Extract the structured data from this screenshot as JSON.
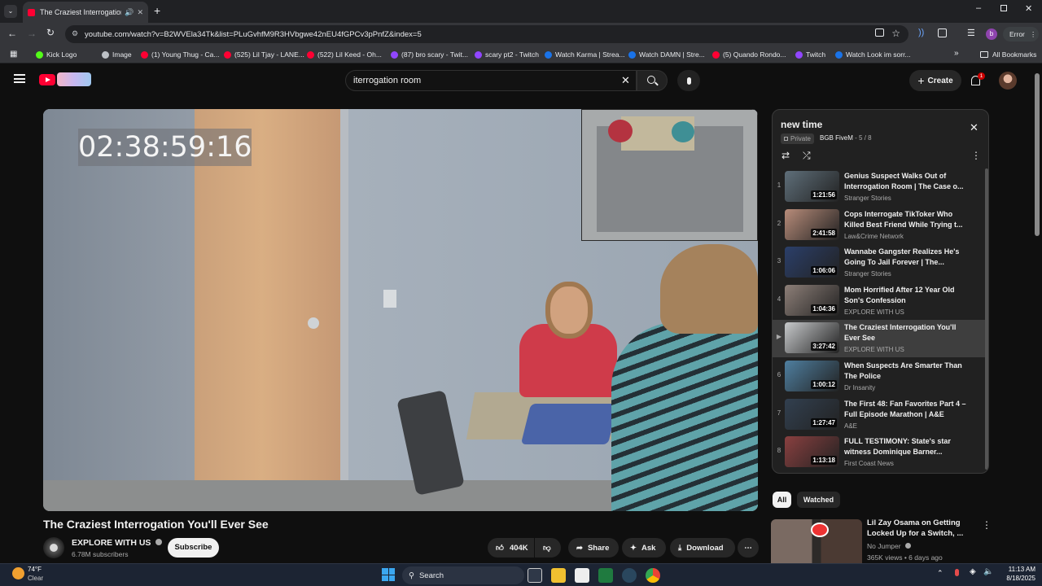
{
  "browser": {
    "tab_title": "The Craziest Interrogation You'll Ever See - YouTube",
    "new_tab": "+",
    "url": "youtube.com/watch?v=B2WVEla34Tk&list=PLuGvhfM9R3HVbgwe42nEU4fGPCv3pPnfZ&index=5",
    "profile_letter": "b",
    "error_label": "Error",
    "bookmarks": [
      {
        "label": "Kick Logo",
        "color": "#53fc18"
      },
      {
        "label": "Image",
        "color": "#bdc1c6"
      },
      {
        "label": "(1) Young Thug - Ca...",
        "color": "#ff0033"
      },
      {
        "label": "(525) Lil Tjay - LANE...",
        "color": "#ff0033"
      },
      {
        "label": "(522) Lil Keed - Oh...",
        "color": "#ff0033"
      },
      {
        "label": "(87) bro scary - Twit...",
        "color": "#9146ff"
      },
      {
        "label": "scary pt2 - Twitch",
        "color": "#9146ff"
      },
      {
        "label": "Watch Karma | Strea...",
        "color": "#1a73e8"
      },
      {
        "label": "Watch DAMN | Stre...",
        "color": "#1a73e8"
      },
      {
        "label": "(5) Quando Rondo...",
        "color": "#ff0033"
      },
      {
        "label": "Twitch",
        "color": "#9146ff"
      },
      {
        "label": "Watch Look im sorr...",
        "color": "#1a73e8"
      }
    ],
    "all_bookmarks": "All Bookmarks"
  },
  "youtube": {
    "search_query": "iterrogation room",
    "create_label": "Create",
    "notification_count": "1",
    "video": {
      "timestamp_overlay": "02:38:59:16",
      "title": "The Craziest Interrogation You'll Ever See",
      "channel": "EXPLORE WITH US",
      "subscribers": "6.78M subscribers",
      "subscribe_label": "Subscribe",
      "likes": "404K",
      "share_label": "Share",
      "ask_label": "Ask",
      "download_label": "Download"
    },
    "playlist": {
      "title": "new time",
      "privacy": "Private",
      "owner": "BGB FiveM",
      "position": "5 / 8",
      "items": [
        {
          "num": "1",
          "title": "Genius Suspect Walks Out of Interrogation Room | The Case o...",
          "channel": "Stranger Stories",
          "duration": "1:21:56"
        },
        {
          "num": "2",
          "title": "Cops Interrogate TikToker Who Killed Best Friend While Trying t...",
          "channel": "Law&Crime Network",
          "duration": "2:41:58"
        },
        {
          "num": "3",
          "title": "Wannabe Gangster Realizes He's Going To Jail Forever | The...",
          "channel": "Stranger Stories",
          "duration": "1:06:06"
        },
        {
          "num": "4",
          "title": "Mom Horrified After 12 Year Old Son's Confession",
          "channel": "EXPLORE WITH US",
          "duration": "1:04:36"
        },
        {
          "num": "▶",
          "title": "The Craziest Interrogation You'll Ever See",
          "channel": "EXPLORE WITH US",
          "duration": "3:27:42"
        },
        {
          "num": "6",
          "title": "When Suspects Are Smarter Than The Police",
          "channel": "Dr Insanity",
          "duration": "1:00:12"
        },
        {
          "num": "7",
          "title": "The First 48: Fan Favorites Part 4 – Full Episode Marathon | A&E",
          "channel": "A&E",
          "duration": "1:27:47"
        },
        {
          "num": "8",
          "title": "FULL TESTIMONY: State's star witness Dominique Barner...",
          "channel": "First Coast News",
          "duration": "1:13:18"
        }
      ]
    },
    "chips": [
      "All",
      "Watched"
    ],
    "recommended": {
      "title": "Lil Zay Osama on Getting Locked Up for a Switch, ...",
      "channel": "No Jumper",
      "meta": "365K views • 6 days ago"
    }
  },
  "taskbar": {
    "temperature": "74°F",
    "weather": "Clear",
    "search_label": "Search",
    "time": "11:13 AM",
    "date": "8/18/2025"
  }
}
